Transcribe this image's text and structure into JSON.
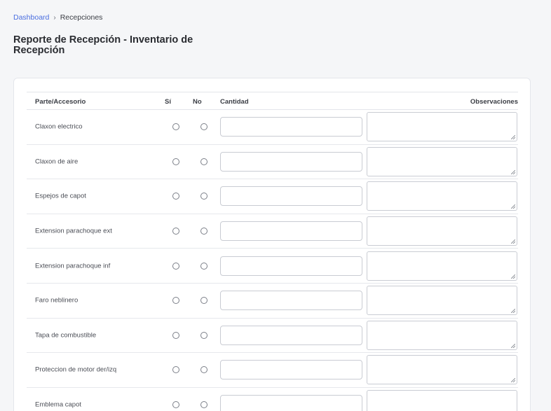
{
  "breadcrumb": {
    "home": "Dashboard",
    "separator": "›",
    "current": "Recepciones"
  },
  "page": {
    "title": "Reporte de Recepción - Inventario de Recepción"
  },
  "table": {
    "headers": {
      "part": "Parte/Accesorio",
      "yes": "Sí",
      "no": "No",
      "quantity": "Cantidad",
      "observations": "Observaciones"
    },
    "rows": [
      {
        "label": "Claxon electrico"
      },
      {
        "label": "Claxon de aire"
      },
      {
        "label": "Espejos de capot"
      },
      {
        "label": "Extension parachoque ext"
      },
      {
        "label": "Extension parachoque inf"
      },
      {
        "label": "Faro neblinero"
      },
      {
        "label": "Tapa de combustible"
      },
      {
        "label": "Proteccion de motor der/izq"
      },
      {
        "label": "Emblema capot"
      }
    ]
  }
}
